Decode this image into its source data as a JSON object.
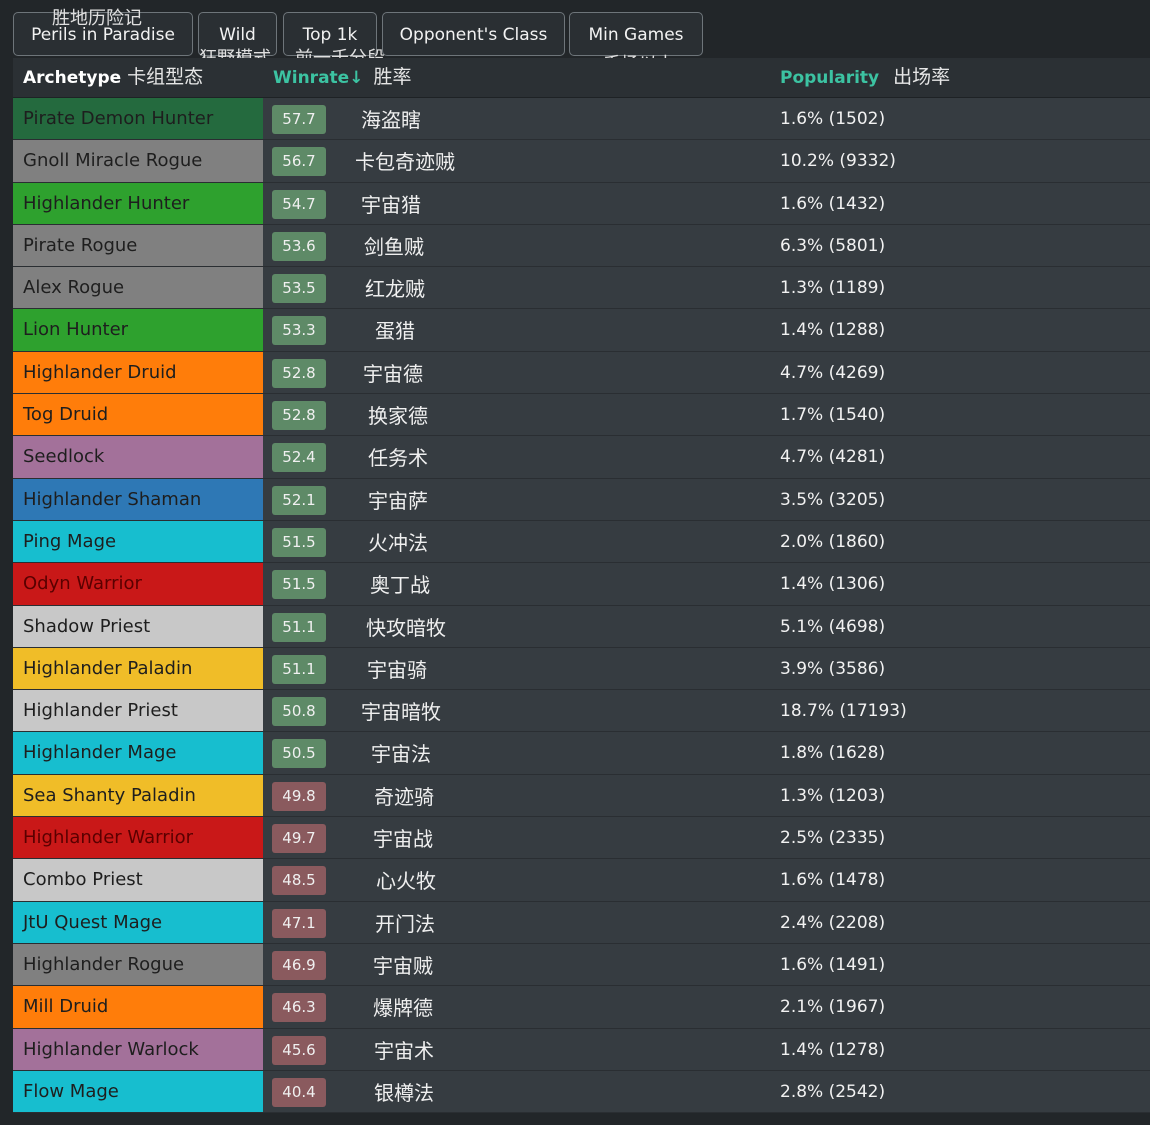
{
  "filters": {
    "expansion": "Perils in Paradise",
    "mode": "Wild",
    "rank": "Top 1k",
    "opponent": "Opponent's Class",
    "min_games": "Min Games"
  },
  "annotations": {
    "expansion_cn": "胜地历险记",
    "mode_cn": "狂野模式",
    "rank_cn": "前一千分段",
    "min_games_cn": "一千场以上"
  },
  "header": {
    "archetype": "Archetype",
    "archetype_cn": "卡组型态",
    "winrate": "Winrate↓",
    "winrate_cn": "胜率",
    "popularity": "Popularity",
    "popularity_cn": "出场率"
  },
  "colors": {
    "demon_hunter": "#246a3e",
    "rogue": "#808080",
    "hunter": "#2ea12e",
    "druid": "#ff7d0a",
    "warlock": "#a3719a",
    "shaman": "#2e78b5",
    "mage": "#17becf",
    "warrior": "#c91818",
    "priest": "#c8c8c8",
    "paladin": "#f0bd28",
    "winrate_high": "#5e8a67",
    "winrate_low": "#8a5a5e",
    "accent": "#3cc3a2"
  },
  "rows": [
    {
      "archetype": "Pirate Demon Hunter",
      "cls": "demon_hunter",
      "winrate": "57.7",
      "cn": "海盗瞎",
      "popularity": "1.6% (1502)"
    },
    {
      "archetype": "Gnoll Miracle Rogue",
      "cls": "rogue",
      "winrate": "56.7",
      "cn": "卡包奇迹贼",
      "popularity": "10.2% (9332)"
    },
    {
      "archetype": "Highlander Hunter",
      "cls": "hunter",
      "winrate": "54.7",
      "cn": "宇宙猎",
      "popularity": "1.6% (1432)"
    },
    {
      "archetype": "Pirate Rogue",
      "cls": "rogue",
      "winrate": "53.6",
      "cn": "剑鱼贼",
      "popularity": "6.3% (5801)"
    },
    {
      "archetype": "Alex Rogue",
      "cls": "rogue",
      "winrate": "53.5",
      "cn": "红龙贼",
      "popularity": "1.3% (1189)"
    },
    {
      "archetype": "Lion Hunter",
      "cls": "hunter",
      "winrate": "53.3",
      "cn": "蛋猎",
      "popularity": "1.4% (1288)"
    },
    {
      "archetype": "Highlander Druid",
      "cls": "druid",
      "winrate": "52.8",
      "cn": "宇宙德",
      "popularity": "4.7% (4269)"
    },
    {
      "archetype": "Tog Druid",
      "cls": "druid",
      "winrate": "52.8",
      "cn": "换家德",
      "popularity": "1.7% (1540)"
    },
    {
      "archetype": "Seedlock",
      "cls": "warlock",
      "winrate": "52.4",
      "cn": "任务术",
      "popularity": "4.7% (4281)"
    },
    {
      "archetype": "Highlander Shaman",
      "cls": "shaman",
      "winrate": "52.1",
      "cn": "宇宙萨",
      "popularity": "3.5% (3205)"
    },
    {
      "archetype": "Ping Mage",
      "cls": "mage",
      "winrate": "51.5",
      "cn": "火冲法",
      "popularity": "2.0% (1860)"
    },
    {
      "archetype": "Odyn Warrior",
      "cls": "warrior",
      "winrate": "51.5",
      "cn": "奥丁战",
      "popularity": "1.4% (1306)"
    },
    {
      "archetype": "Shadow Priest",
      "cls": "priest",
      "winrate": "51.1",
      "cn": "快攻暗牧",
      "popularity": "5.1% (4698)"
    },
    {
      "archetype": "Highlander Paladin",
      "cls": "paladin",
      "winrate": "51.1",
      "cn": "宇宙骑",
      "popularity": "3.9% (3586)"
    },
    {
      "archetype": "Highlander Priest",
      "cls": "priest",
      "winrate": "50.8",
      "cn": "宇宙暗牧",
      "popularity": "18.7% (17193)"
    },
    {
      "archetype": "Highlander Mage",
      "cls": "mage",
      "winrate": "50.5",
      "cn": "宇宙法",
      "popularity": "1.8% (1628)"
    },
    {
      "archetype": "Sea Shanty Paladin",
      "cls": "paladin",
      "winrate": "49.8",
      "cn": "奇迹骑",
      "popularity": "1.3% (1203)"
    },
    {
      "archetype": "Highlander Warrior",
      "cls": "warrior",
      "winrate": "49.7",
      "cn": "宇宙战",
      "popularity": "2.5% (2335)"
    },
    {
      "archetype": "Combo Priest",
      "cls": "priest",
      "winrate": "48.5",
      "cn": "心火牧",
      "popularity": "1.6% (1478)"
    },
    {
      "archetype": "JtU Quest Mage",
      "cls": "mage",
      "winrate": "47.1",
      "cn": "开门法",
      "popularity": "2.4% (2208)"
    },
    {
      "archetype": "Highlander Rogue",
      "cls": "rogue",
      "winrate": "46.9",
      "cn": "宇宙贼",
      "popularity": "1.6% (1491)"
    },
    {
      "archetype": "Mill Druid",
      "cls": "druid",
      "winrate": "46.3",
      "cn": "爆牌德",
      "popularity": "2.1% (1967)"
    },
    {
      "archetype": "Highlander Warlock",
      "cls": "warlock",
      "winrate": "45.6",
      "cn": "宇宙术",
      "popularity": "1.4% (1278)"
    },
    {
      "archetype": "Flow Mage",
      "cls": "mage",
      "winrate": "40.4",
      "cn": "银樽法",
      "popularity": "2.8% (2542)"
    }
  ]
}
